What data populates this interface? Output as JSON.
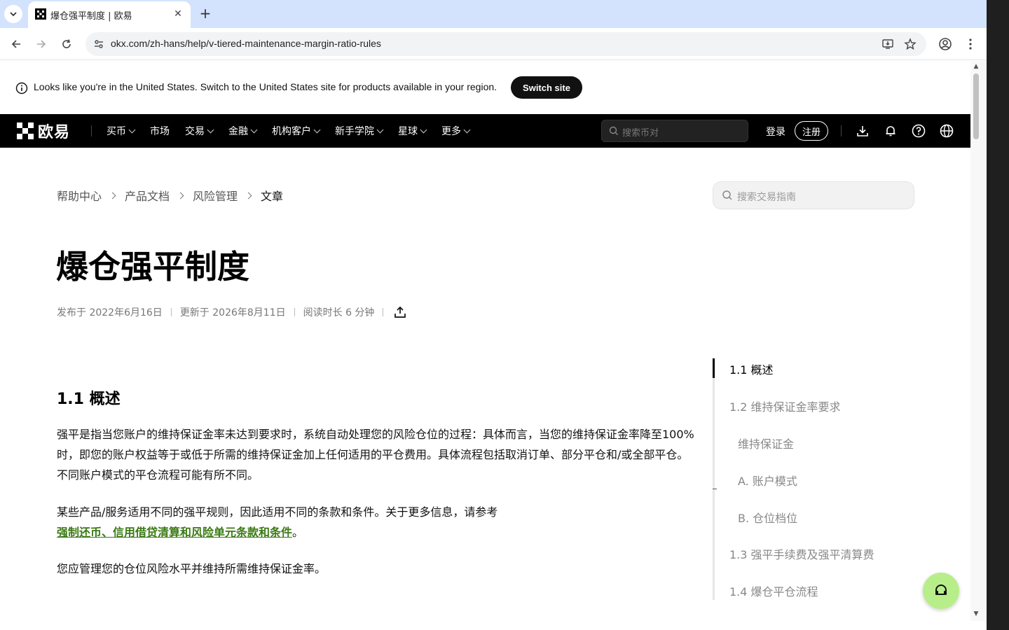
{
  "browser": {
    "tab_title": "爆仓强平制度 | 欧易",
    "url": "okx.com/zh-hans/help/v-tiered-maintenance-margin-ratio-rules"
  },
  "region_banner": {
    "message": "Looks like you're in the United States. Switch to the United States site for products available in your region.",
    "button_label": "Switch site"
  },
  "site_nav": {
    "logo_text": "欧易",
    "items": [
      {
        "label": "买币",
        "has_menu": true
      },
      {
        "label": "市场",
        "has_menu": false
      },
      {
        "label": "交易",
        "has_menu": true
      },
      {
        "label": "金融",
        "has_menu": true
      },
      {
        "label": "机构客户",
        "has_menu": true
      },
      {
        "label": "新手学院",
        "has_menu": true
      },
      {
        "label": "星球",
        "has_menu": true
      },
      {
        "label": "更多",
        "has_menu": true
      }
    ],
    "search_placeholder": "搜索币对",
    "login_label": "登录",
    "register_label": "注册"
  },
  "breadcrumb": [
    "帮助中心",
    "产品文档",
    "风险管理",
    "文章"
  ],
  "help_search_placeholder": "搜索交易指南",
  "article": {
    "title": "爆仓强平制度",
    "published": "发布于 2022年6月16日",
    "updated": "更新于 2026年8月11日",
    "read_time": "阅读时长 6 分钟",
    "section_heading": "1.1 概述",
    "para1_line1": "强平是指当您账户的维持保证金率未达到要求时，系统自动处理您的风险仓位的过程：具体而言，当您的维持保证金率降至100%",
    "para1_line2": "时，即您的账户权益等于或低于所需的维持保证金加上任何适用的平仓费用。具体流程包括取消订单、部分平仓和/或全部平仓。",
    "para1_line3": "不同账户模式的平仓流程可能有所不同。",
    "para2_text": "某些产品/服务适用不同的强平规则，因此适用不同的条款和条件。关于更多信息，请参考",
    "para2_link": "强制还币、信用借贷清算和风险单元条款和条件",
    "para2_end": "。",
    "para3": "您应管理您的仓位风险水平并维持所需维持保证金率。"
  },
  "toc": [
    {
      "label": "1.1 概述",
      "active": true,
      "indent": false
    },
    {
      "label": "1.2 维持保证金率要求",
      "active": false,
      "indent": false
    },
    {
      "label": "维持保证金",
      "active": false,
      "indent": true
    },
    {
      "label": "A. 账户模式",
      "active": false,
      "indent": true
    },
    {
      "label": "B. 仓位档位",
      "active": false,
      "indent": true
    },
    {
      "label": "1.3 强平手续费及强平清算费",
      "active": false,
      "indent": false
    },
    {
      "label": "1.4 爆仓平仓流程",
      "active": false,
      "indent": false
    }
  ],
  "colors": {
    "link": "#3a7a14",
    "support_button": "#b8ee8a",
    "nav_background": "#000000"
  }
}
